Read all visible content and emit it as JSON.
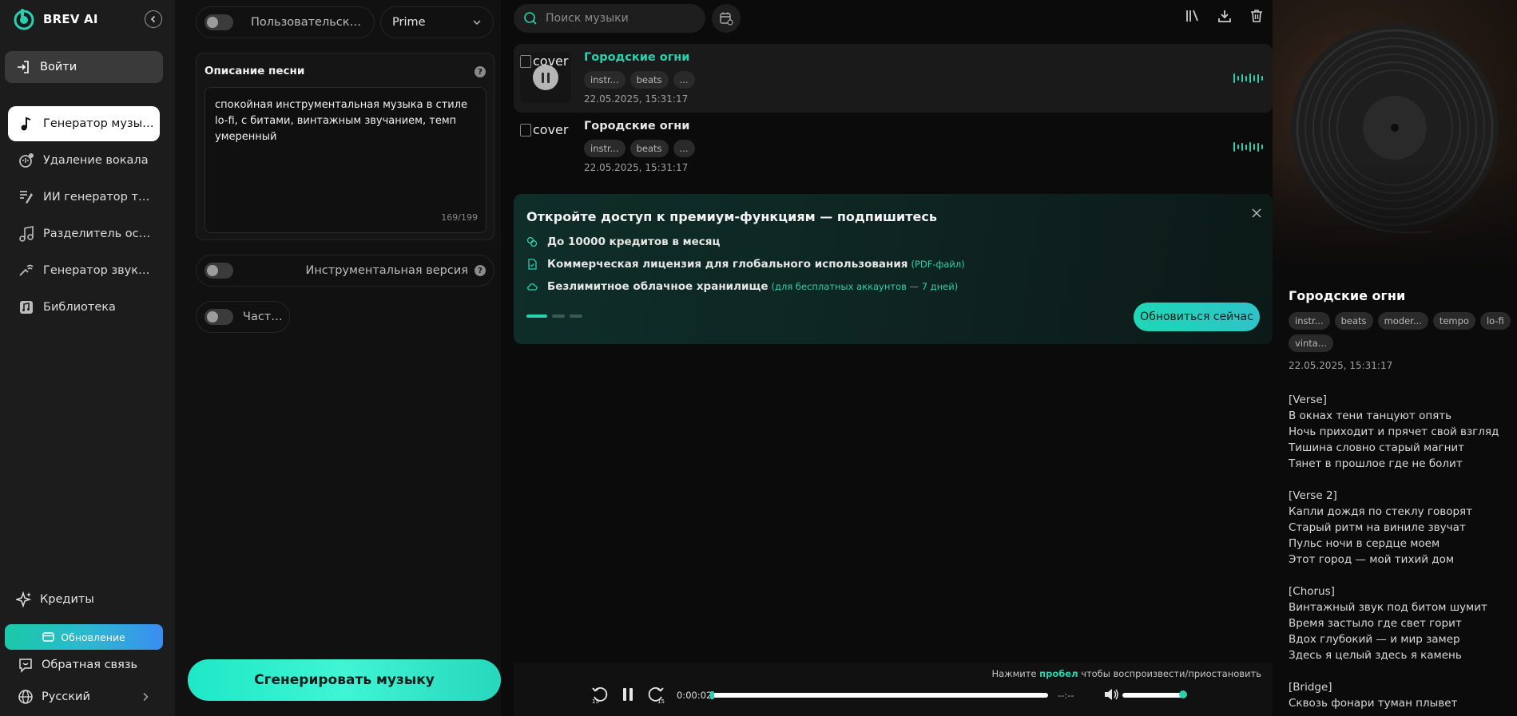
{
  "brand": {
    "name": "BREV AI"
  },
  "sidebar": {
    "login_label": "Войти",
    "nav": [
      {
        "label": "Генератор музыки",
        "icon": "music-note-icon",
        "active": true
      },
      {
        "label": "Удаление вокала",
        "icon": "vocal-remover-icon",
        "active": false
      },
      {
        "label": "ИИ генератор текстов",
        "icon": "lyrics-generator-icon",
        "active": false
      },
      {
        "label": "Разделитель основ",
        "icon": "stem-splitter-icon",
        "active": false
      },
      {
        "label": "Генератор звуковых эффектов",
        "icon": "sound-effects-icon",
        "active": false
      },
      {
        "label": "Библиотека",
        "icon": "library-icon",
        "active": false
      }
    ],
    "credits_label": "Кредиты",
    "upgrade_label": "Обновление",
    "feedback_label": "Обратная связь",
    "language_label": "Русский"
  },
  "form": {
    "custom_mode_label": "Пользовательский режим",
    "model_value": "Prime",
    "description_title": "Описание песни",
    "description_value": "спокойная инструментальная музыка в стиле lo-fi, с битами, винтажным звучанием, темп умеренный",
    "description_count": "169/199",
    "instrumental_label": "Инструментальная версия",
    "private_label": "Частный",
    "generate_label": "Сгенерировать музыку"
  },
  "main": {
    "search_placeholder": "Поиск музыки",
    "songs": [
      {
        "title": "Городские огни",
        "cover_alt": "cover",
        "tags": [
          "instr...",
          "beats",
          "..."
        ],
        "date": "22.05.2025, 15:31:17",
        "playing": true
      },
      {
        "title": "Городские огни",
        "cover_alt": "cover",
        "tags": [
          "instr...",
          "beats",
          "..."
        ],
        "date": "22.05.2025, 15:31:17",
        "playing": false
      }
    ],
    "promo": {
      "title": "Откройте доступ к премиум-функциям — подпишитесь",
      "features": [
        {
          "text": "До 10000 кредитов в месяц",
          "note": "",
          "icon": "coins-icon"
        },
        {
          "text": "Коммерческая лицензия для глобального использования",
          "note": "(PDF-файл)",
          "icon": "document-icon"
        },
        {
          "text": "Безлимитное облачное хранилище",
          "note": "(для бесплатных аккаунтов — 7 дней)",
          "icon": "cloud-icon"
        }
      ],
      "button_label": "Обновиться сейчас"
    },
    "player": {
      "hint_prefix": "Нажмите",
      "hint_key": "пробел",
      "hint_suffix": "чтобы воспроизвести/приостановить",
      "rewind_label": "15",
      "forward_label": "15",
      "current_time": "0:00:02",
      "total_time": "--:--",
      "progress": 0.0,
      "volume": 1.0
    }
  },
  "detail": {
    "title": "Городские огни",
    "tags": [
      "instr...",
      "beats",
      "moder...",
      "tempo",
      "lo-fi",
      "vinta..."
    ],
    "date": "22.05.2025, 15:31:17",
    "lyrics": [
      [
        "[Verse]",
        "В окнах тени танцуют опять",
        "Ночь приходит и прячет свой взгляд",
        "Тишина словно старый магнит",
        "Тянет в прошлое где не болит"
      ],
      [
        "[Verse 2]",
        "Капли дождя по стеклу говорят",
        "Старый ритм на виниле звучат",
        "Пульс ночи в сердце моем",
        "Этот город — мой тихий дом"
      ],
      [
        "[Chorus]",
        "Винтажный звук под битом шумит",
        "Время застыло где свет горит",
        "Вдох глубокий — и мир замер",
        "Здесь я целый здесь я камень"
      ],
      [
        "[Bridge]",
        "Сквозь фонари туман плывет"
      ]
    ]
  },
  "colors": {
    "accent": "#2ad1ae",
    "sidebar_bg": "#1c1c1c",
    "panel_bg": "#111111"
  }
}
